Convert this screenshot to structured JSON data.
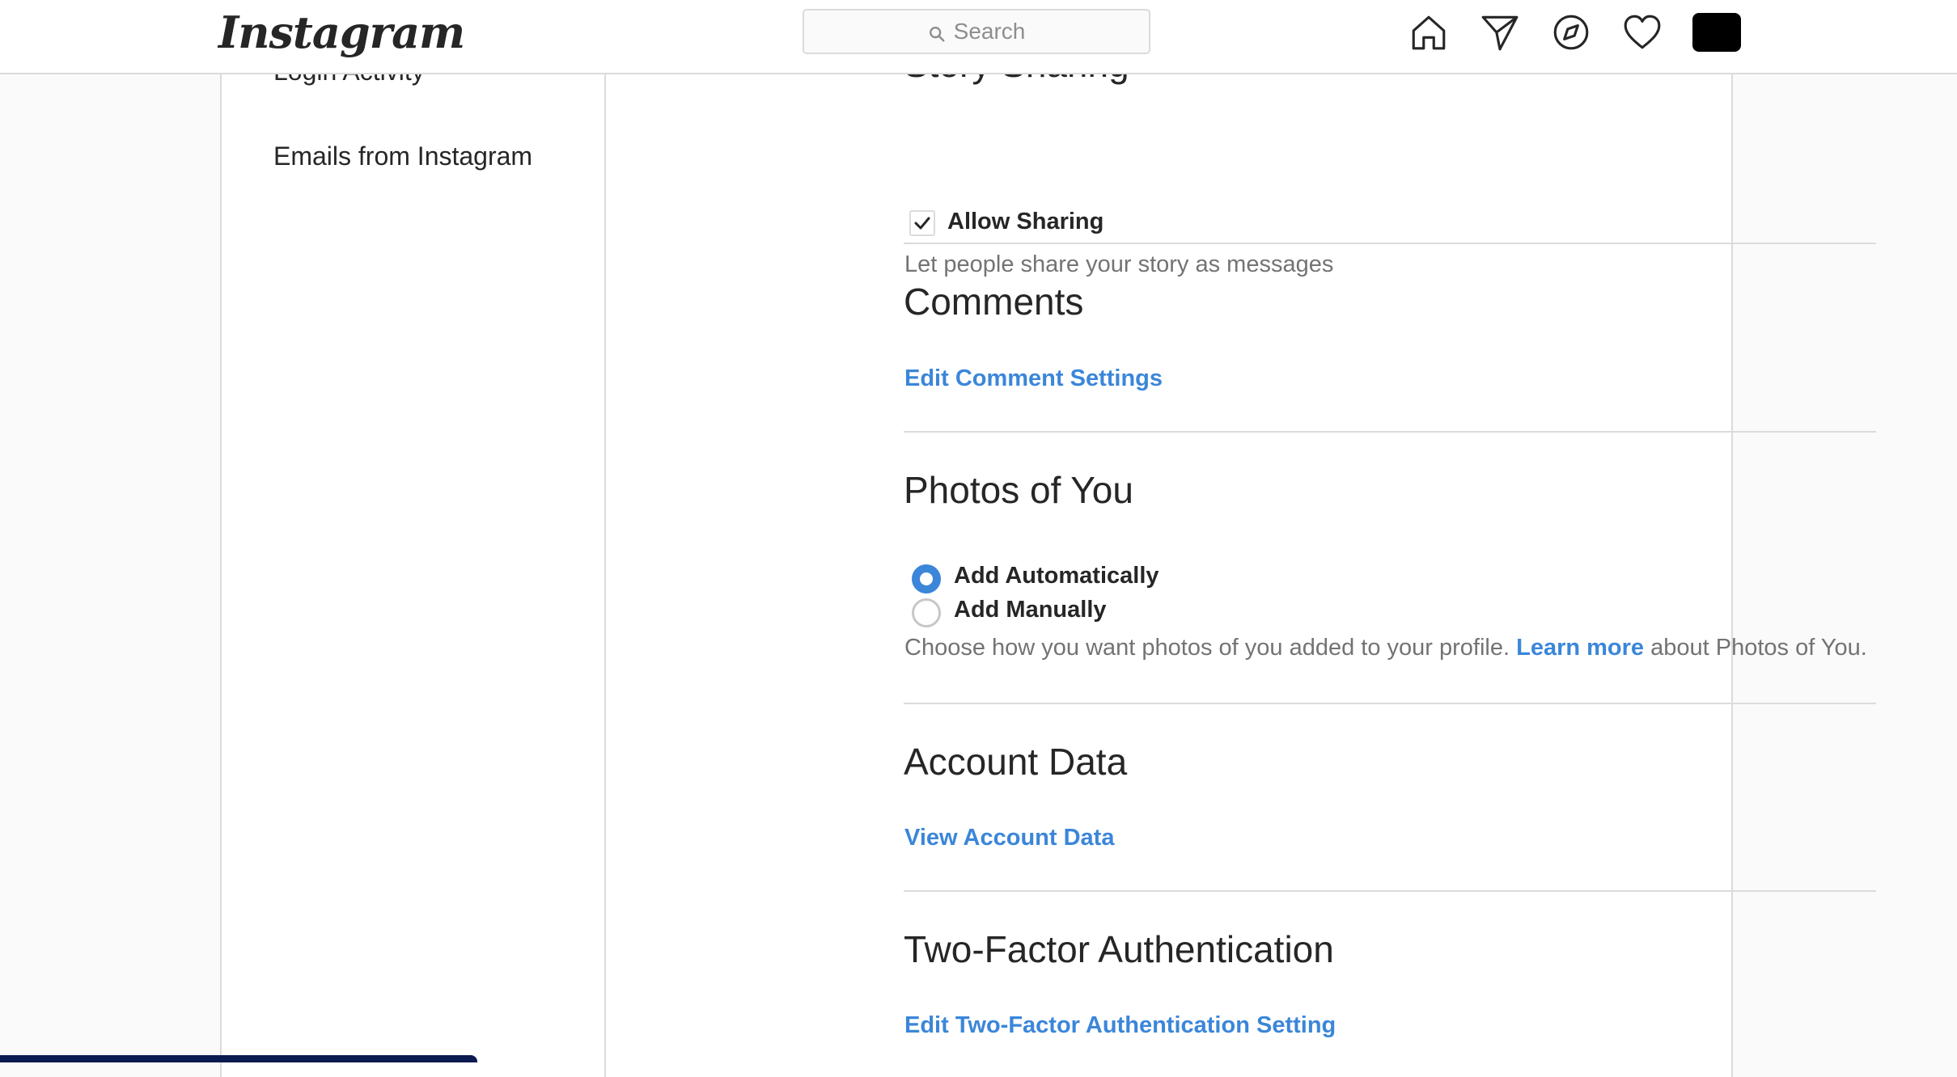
{
  "nav": {
    "logo_text": "Instagram",
    "search_placeholder": "Search",
    "icons": [
      "home-icon",
      "direct-message-icon",
      "explore-icon",
      "activity-heart-icon",
      "profile-avatar"
    ]
  },
  "sidebar": {
    "items": [
      {
        "label": "Login Activity"
      },
      {
        "label": "Emails from Instagram"
      }
    ]
  },
  "story_sharing": {
    "title": "Story Sharing",
    "checkbox_label": "Allow Sharing",
    "checked": true,
    "help": "Let people share your story as messages"
  },
  "comments": {
    "title": "Comments",
    "link": "Edit Comment Settings"
  },
  "photos_of_you": {
    "title": "Photos of You",
    "options": [
      {
        "label": "Add Automatically",
        "selected": true
      },
      {
        "label": "Add Manually",
        "selected": false
      }
    ],
    "help_prefix": "Choose how you want photos of you added to your profile. ",
    "help_link": "Learn more",
    "help_suffix": " about Photos of You."
  },
  "account_data": {
    "title": "Account Data",
    "link": "View Account Data"
  },
  "two_factor": {
    "title": "Two-Factor Authentication",
    "link": "Edit Two-Factor Authentication Setting"
  },
  "colors": {
    "link_blue": "#3b86d9",
    "divider": "#dbdbdb",
    "text": "#262626",
    "secondary_text": "#737373"
  }
}
